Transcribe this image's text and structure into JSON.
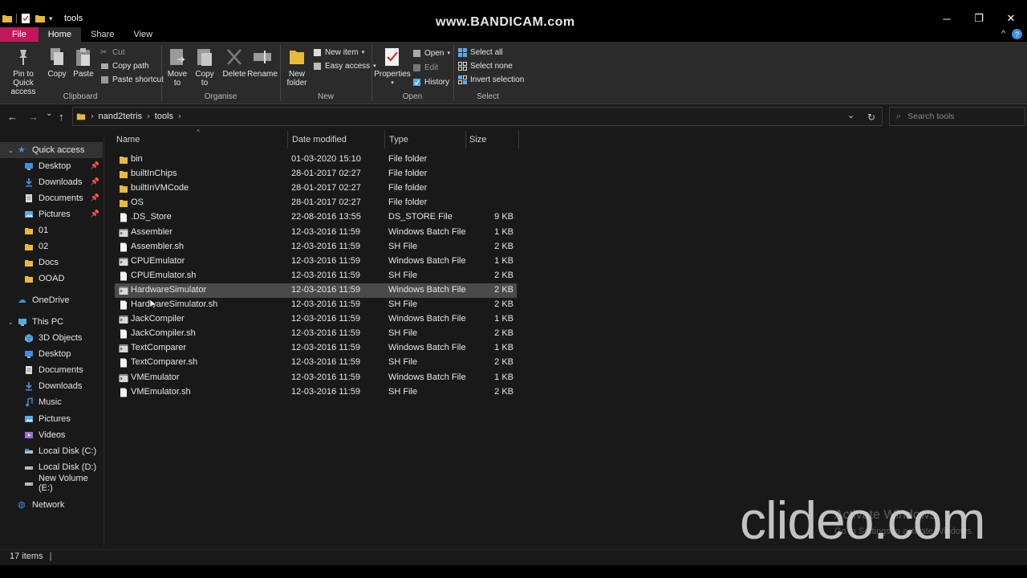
{
  "window": {
    "title": "tools",
    "watermark": "www.BANDICAM.com",
    "controls": {
      "minimize": "─",
      "maximize": "❐",
      "close": "✕"
    }
  },
  "ribbon_tabs": [
    "File",
    "Home",
    "Share",
    "View"
  ],
  "ribbon_right": {
    "collapse": "^",
    "help": "?"
  },
  "ribbon": {
    "clipboard": {
      "label": "Clipboard",
      "pin": "Pin to Quick\naccess",
      "copy": "Copy",
      "paste": "Paste",
      "cut": "Cut",
      "copy_path": "Copy path",
      "paste_shortcut": "Paste shortcut"
    },
    "organise": {
      "label": "Organise",
      "move_to": "Move\nto",
      "copy_to": "Copy\nto",
      "delete": "Delete",
      "rename": "Rename"
    },
    "new": {
      "label": "New",
      "new_folder": "New\nfolder",
      "new_item": "New item",
      "easy_access": "Easy access"
    },
    "open": {
      "label": "Open",
      "properties": "Properties",
      "open": "Open",
      "edit": "Edit",
      "history": "History"
    },
    "select": {
      "label": "Select",
      "select_all": "Select all",
      "select_none": "Select none",
      "invert_selection": "Invert selection"
    }
  },
  "address": {
    "crumbs": [
      "nand2tetris",
      "tools"
    ],
    "separator": "›",
    "search_placeholder": "Search tools",
    "back": "←",
    "forward": "→",
    "recent": "⌄",
    "up": "↑",
    "dropdown": "⌄",
    "refresh": "↻"
  },
  "sidebar": {
    "quick_access": "Quick access",
    "quick_items": [
      {
        "label": "Desktop",
        "pinned": true,
        "icon": "desktop-icon"
      },
      {
        "label": "Downloads",
        "pinned": true,
        "icon": "downloads-icon"
      },
      {
        "label": "Documents",
        "pinned": true,
        "icon": "documents-icon"
      },
      {
        "label": "Pictures",
        "pinned": true,
        "icon": "pictures-icon"
      },
      {
        "label": "01",
        "pinned": false,
        "icon": "folder-icon"
      },
      {
        "label": "02",
        "pinned": false,
        "icon": "folder-icon"
      },
      {
        "label": "Docs",
        "pinned": false,
        "icon": "folder-icon"
      },
      {
        "label": "OOAD",
        "pinned": false,
        "icon": "folder-icon"
      }
    ],
    "onedrive": "OneDrive",
    "this_pc": "This PC",
    "pc_items": [
      {
        "label": "3D Objects",
        "icon": "3d-objects-icon"
      },
      {
        "label": "Desktop",
        "icon": "desktop-icon"
      },
      {
        "label": "Documents",
        "icon": "documents-icon"
      },
      {
        "label": "Downloads",
        "icon": "downloads-icon"
      },
      {
        "label": "Music",
        "icon": "music-icon"
      },
      {
        "label": "Pictures",
        "icon": "pictures-icon"
      },
      {
        "label": "Videos",
        "icon": "videos-icon"
      },
      {
        "label": "Local Disk (C:)",
        "icon": "drive-c-icon"
      },
      {
        "label": "Local Disk (D:)",
        "icon": "drive-icon"
      },
      {
        "label": "New Volume (E:)",
        "icon": "drive-icon"
      }
    ],
    "network": "Network"
  },
  "columns": {
    "name": "Name",
    "date": "Date modified",
    "type": "Type",
    "size": "Size"
  },
  "files": [
    {
      "name": "bin",
      "date": "01-03-2020 15:10",
      "type": "File folder",
      "size": "",
      "kind": "folder"
    },
    {
      "name": "builtInChips",
      "date": "28-01-2017 02:27",
      "type": "File folder",
      "size": "",
      "kind": "folder"
    },
    {
      "name": "builtInVMCode",
      "date": "28-01-2017 02:27",
      "type": "File folder",
      "size": "",
      "kind": "folder"
    },
    {
      "name": "OS",
      "date": "28-01-2017 02:27",
      "type": "File folder",
      "size": "",
      "kind": "folder"
    },
    {
      "name": ".DS_Store",
      "date": "22-08-2016 13:55",
      "type": "DS_STORE File",
      "size": "9 KB",
      "kind": "file"
    },
    {
      "name": "Assembler",
      "date": "12-03-2016 11:59",
      "type": "Windows Batch File",
      "size": "1 KB",
      "kind": "batch"
    },
    {
      "name": "Assembler.sh",
      "date": "12-03-2016 11:59",
      "type": "SH File",
      "size": "2 KB",
      "kind": "file"
    },
    {
      "name": "CPUEmulator",
      "date": "12-03-2016 11:59",
      "type": "Windows Batch File",
      "size": "1 KB",
      "kind": "batch"
    },
    {
      "name": "CPUEmulator.sh",
      "date": "12-03-2016 11:59",
      "type": "SH File",
      "size": "2 KB",
      "kind": "file"
    },
    {
      "name": "HardwareSimulator",
      "date": "12-03-2016 11:59",
      "type": "Windows Batch File",
      "size": "2 KB",
      "kind": "batch",
      "hover": true
    },
    {
      "name": "HardwareSimulator.sh",
      "date": "12-03-2016 11:59",
      "type": "SH File",
      "size": "2 KB",
      "kind": "file"
    },
    {
      "name": "JackCompiler",
      "date": "12-03-2016 11:59",
      "type": "Windows Batch File",
      "size": "1 KB",
      "kind": "batch"
    },
    {
      "name": "JackCompiler.sh",
      "date": "12-03-2016 11:59",
      "type": "SH File",
      "size": "2 KB",
      "kind": "file"
    },
    {
      "name": "TextComparer",
      "date": "12-03-2016 11:59",
      "type": "Windows Batch File",
      "size": "1 KB",
      "kind": "batch"
    },
    {
      "name": "TextComparer.sh",
      "date": "12-03-2016 11:59",
      "type": "SH File",
      "size": "2 KB",
      "kind": "file"
    },
    {
      "name": "VMEmulator",
      "date": "12-03-2016 11:59",
      "type": "Windows Batch File",
      "size": "1 KB",
      "kind": "batch"
    },
    {
      "name": "VMEmulator.sh",
      "date": "12-03-2016 11:59",
      "type": "SH File",
      "size": "2 KB",
      "kind": "file"
    }
  ],
  "status": {
    "item_count": "17 items"
  },
  "overlays": {
    "activate_title": "Activate Windows",
    "activate_sub": "Go to Settings to activate Windows.",
    "clideo": "clideo.com"
  },
  "colors": {
    "file_tab": "#c2185b",
    "folder": "#e8b93a",
    "accent_blue": "#3d8fe0",
    "hover_row": "#4a4a4a"
  }
}
